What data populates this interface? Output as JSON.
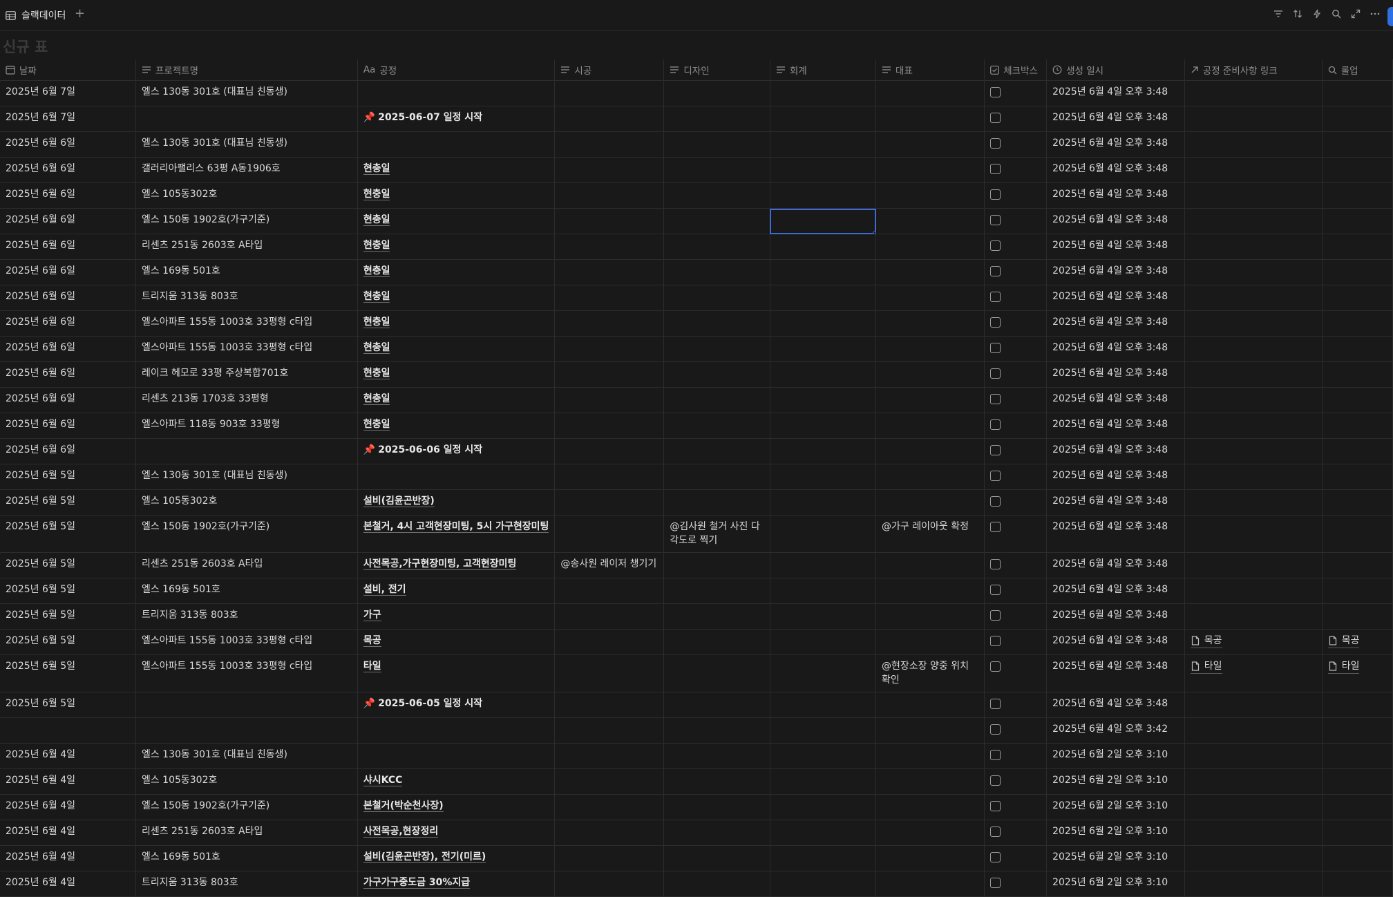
{
  "view": {
    "tab_label": "슬랙데이터",
    "add_label": "+"
  },
  "page_title": "신규 표",
  "columns": [
    "날짜",
    "프로젝트명",
    "공정",
    "시공",
    "디자인",
    "회계",
    "대표",
    "체크박스",
    "생성 일시",
    "공정 준비사항 링크",
    "롤업"
  ],
  "column_type_prefix": "Aa",
  "rows": [
    {
      "date": "2025년 6월 7일",
      "project": "엘스 130동 301호 (대표님 친동생)",
      "process": "",
      "pin": false,
      "build": "",
      "design": "",
      "account": "",
      "rep": "",
      "created": "2025년 6월 4일 오후 3:48",
      "link": "",
      "rollup": ""
    },
    {
      "date": "2025년 6월 7일",
      "project": "",
      "process": "2025-06-07 일정 시작",
      "pin": true,
      "build": "",
      "design": "",
      "account": "",
      "rep": "",
      "created": "2025년 6월 4일 오후 3:48",
      "link": "",
      "rollup": ""
    },
    {
      "date": "2025년 6월 6일",
      "project": "엘스 130동 301호 (대표님 친동생)",
      "process": "",
      "pin": false,
      "build": "",
      "design": "",
      "account": "",
      "rep": "",
      "created": "2025년 6월 4일 오후 3:48",
      "link": "",
      "rollup": ""
    },
    {
      "date": "2025년 6월 6일",
      "project": "갤러리아팰리스 63평 A동1906호",
      "process": "현충일",
      "pin": false,
      "build": "",
      "design": "",
      "account": "",
      "rep": "",
      "created": "2025년 6월 4일 오후 3:48",
      "link": "",
      "rollup": ""
    },
    {
      "date": "2025년 6월 6일",
      "project": "엘스 105동302호",
      "process": "현충일",
      "pin": false,
      "build": "",
      "design": "",
      "account": "",
      "rep": "",
      "created": "2025년 6월 4일 오후 3:48",
      "link": "",
      "rollup": ""
    },
    {
      "date": "2025년 6월 6일",
      "project": "엘스 150동 1902호(가구기준)",
      "process": "현충일",
      "pin": false,
      "build": "",
      "design": "",
      "account": "",
      "rep": "",
      "created": "2025년 6월 4일 오후 3:48",
      "link": "",
      "rollup": "",
      "selected": true
    },
    {
      "date": "2025년 6월 6일",
      "project": "리센츠 251동 2603호 A타입",
      "process": "현충일",
      "pin": false,
      "build": "",
      "design": "",
      "account": "",
      "rep": "",
      "created": "2025년 6월 4일 오후 3:48",
      "link": "",
      "rollup": ""
    },
    {
      "date": "2025년 6월 6일",
      "project": "엘스 169동 501호",
      "process": "현충일",
      "pin": false,
      "build": "",
      "design": "",
      "account": "",
      "rep": "",
      "created": "2025년 6월 4일 오후 3:48",
      "link": "",
      "rollup": ""
    },
    {
      "date": "2025년 6월 6일",
      "project": "트리지움 313동 803호",
      "process": "현충일",
      "pin": false,
      "build": "",
      "design": "",
      "account": "",
      "rep": "",
      "created": "2025년 6월 4일 오후 3:48",
      "link": "",
      "rollup": ""
    },
    {
      "date": "2025년 6월 6일",
      "project": "엘스아파트 155동 1003호 33평형 c타입",
      "process": "현충일",
      "pin": false,
      "build": "",
      "design": "",
      "account": "",
      "rep": "",
      "created": "2025년 6월 4일 오후 3:48",
      "link": "",
      "rollup": ""
    },
    {
      "date": "2025년 6월 6일",
      "project": "엘스아파트 155동 1003호 33평형 c타입",
      "process": "현충일",
      "pin": false,
      "build": "",
      "design": "",
      "account": "",
      "rep": "",
      "created": "2025년 6월 4일 오후 3:48",
      "link": "",
      "rollup": ""
    },
    {
      "date": "2025년 6월 6일",
      "project": "레이크 헤모로 33평 주상복합701호",
      "process": "현충일",
      "pin": false,
      "build": "",
      "design": "",
      "account": "",
      "rep": "",
      "created": "2025년 6월 4일 오후 3:48",
      "link": "",
      "rollup": ""
    },
    {
      "date": "2025년 6월 6일",
      "project": "리센츠 213동 1703호 33평형",
      "process": "현충일",
      "pin": false,
      "build": "",
      "design": "",
      "account": "",
      "rep": "",
      "created": "2025년 6월 4일 오후 3:48",
      "link": "",
      "rollup": ""
    },
    {
      "date": "2025년 6월 6일",
      "project": "엘스아파트 118동 903호 33평형",
      "process": "현충일",
      "pin": false,
      "build": "",
      "design": "",
      "account": "",
      "rep": "",
      "created": "2025년 6월 4일 오후 3:48",
      "link": "",
      "rollup": ""
    },
    {
      "date": "2025년 6월 6일",
      "project": "",
      "process": "2025-06-06 일정 시작",
      "pin": true,
      "build": "",
      "design": "",
      "account": "",
      "rep": "",
      "created": "2025년 6월 4일 오후 3:48",
      "link": "",
      "rollup": ""
    },
    {
      "date": "2025년 6월 5일",
      "project": "엘스 130동 301호 (대표님 친동생)",
      "process": "",
      "pin": false,
      "build": "",
      "design": "",
      "account": "",
      "rep": "",
      "created": "2025년 6월 4일 오후 3:48",
      "link": "",
      "rollup": ""
    },
    {
      "date": "2025년 6월 5일",
      "project": "엘스 105동302호",
      "process": "설비(김윤곤반장)",
      "pin": false,
      "build": "",
      "design": "",
      "account": "",
      "rep": "",
      "created": "2025년 6월 4일 오후 3:48",
      "link": "",
      "rollup": ""
    },
    {
      "date": "2025년 6월 5일",
      "project": "엘스 150동 1902호(가구기준)",
      "process": "본철거, 4시 고객현장미팅, 5시 가구현장미팅",
      "pin": false,
      "build": "",
      "design": "@김사원 철거 사진 다각도로 찍기",
      "account": "",
      "rep": "@가구 레이아웃 확정",
      "created": "2025년 6월 4일 오후 3:48",
      "link": "",
      "rollup": "",
      "tall": true
    },
    {
      "date": "2025년 6월 5일",
      "project": "리센츠 251동 2603호 A타입",
      "process": "사전목공,가구현장미팅, 고객현장미팅",
      "pin": false,
      "build": "@송사원 레이저 챙기기",
      "design": "",
      "account": "",
      "rep": "",
      "created": "2025년 6월 4일 오후 3:48",
      "link": "",
      "rollup": ""
    },
    {
      "date": "2025년 6월 5일",
      "project": "엘스 169동 501호",
      "process": "설비, 전기",
      "pin": false,
      "build": "",
      "design": "",
      "account": "",
      "rep": "",
      "created": "2025년 6월 4일 오후 3:48",
      "link": "",
      "rollup": ""
    },
    {
      "date": "2025년 6월 5일",
      "project": "트리지움 313동 803호",
      "process": "가구",
      "pin": false,
      "build": "",
      "design": "",
      "account": "",
      "rep": "",
      "created": "2025년 6월 4일 오후 3:48",
      "link": "",
      "rollup": ""
    },
    {
      "date": "2025년 6월 5일",
      "project": "엘스아파트 155동 1003호 33평형 c타입",
      "process": "목공",
      "pin": false,
      "build": "",
      "design": "",
      "account": "",
      "rep": "",
      "created": "2025년 6월 4일 오후 3:48",
      "link": "목공",
      "rollup": "목공"
    },
    {
      "date": "2025년 6월 5일",
      "project": "엘스아파트 155동 1003호 33평형 c타입",
      "process": "타일",
      "pin": false,
      "build": "",
      "design": "",
      "account": "",
      "rep": "@현장소장 양중 위치 확인",
      "created": "2025년 6월 4일 오후 3:48",
      "link": "타일",
      "rollup": "타일",
      "tall": true
    },
    {
      "date": "2025년 6월 5일",
      "project": "",
      "process": "2025-06-05 일정 시작",
      "pin": true,
      "build": "",
      "design": "",
      "account": "",
      "rep": "",
      "created": "2025년 6월 4일 오후 3:48",
      "link": "",
      "rollup": ""
    },
    {
      "date": "",
      "project": "",
      "process": "",
      "pin": false,
      "build": "",
      "design": "",
      "account": "",
      "rep": "",
      "created": "2025년 6월 4일 오후 3:42",
      "link": "",
      "rollup": ""
    },
    {
      "date": "2025년 6월 4일",
      "project": "엘스 130동 301호 (대표님 친동생)",
      "process": "",
      "pin": false,
      "build": "",
      "design": "",
      "account": "",
      "rep": "",
      "created": "2025년 6월 2일 오후 3:10",
      "link": "",
      "rollup": ""
    },
    {
      "date": "2025년 6월 4일",
      "project": "엘스 105동302호",
      "process": "샤시KCC",
      "pin": false,
      "build": "",
      "design": "",
      "account": "",
      "rep": "",
      "created": "2025년 6월 2일 오후 3:10",
      "link": "",
      "rollup": ""
    },
    {
      "date": "2025년 6월 4일",
      "project": "엘스 150동 1902호(가구기준)",
      "process": "본철거(박순천사장)",
      "pin": false,
      "build": "",
      "design": "",
      "account": "",
      "rep": "",
      "created": "2025년 6월 2일 오후 3:10",
      "link": "",
      "rollup": ""
    },
    {
      "date": "2025년 6월 4일",
      "project": "리센츠 251동 2603호 A타입",
      "process": "사전목공,현장정리",
      "pin": false,
      "build": "",
      "design": "",
      "account": "",
      "rep": "",
      "created": "2025년 6월 2일 오후 3:10",
      "link": "",
      "rollup": ""
    },
    {
      "date": "2025년 6월 4일",
      "project": "엘스 169동 501호",
      "process": "설비(김윤곤반장), 전기(미르)",
      "pin": false,
      "build": "",
      "design": "",
      "account": "",
      "rep": "",
      "created": "2025년 6월 2일 오후 3:10",
      "link": "",
      "rollup": ""
    },
    {
      "date": "2025년 6월 4일",
      "project": "트리지움 313동 803호",
      "process": "가구가구중도금 30%지급",
      "pin": false,
      "build": "",
      "design": "",
      "account": "",
      "rep": "",
      "created": "2025년 6월 2일 오후 3:10",
      "link": "",
      "rollup": ""
    }
  ]
}
